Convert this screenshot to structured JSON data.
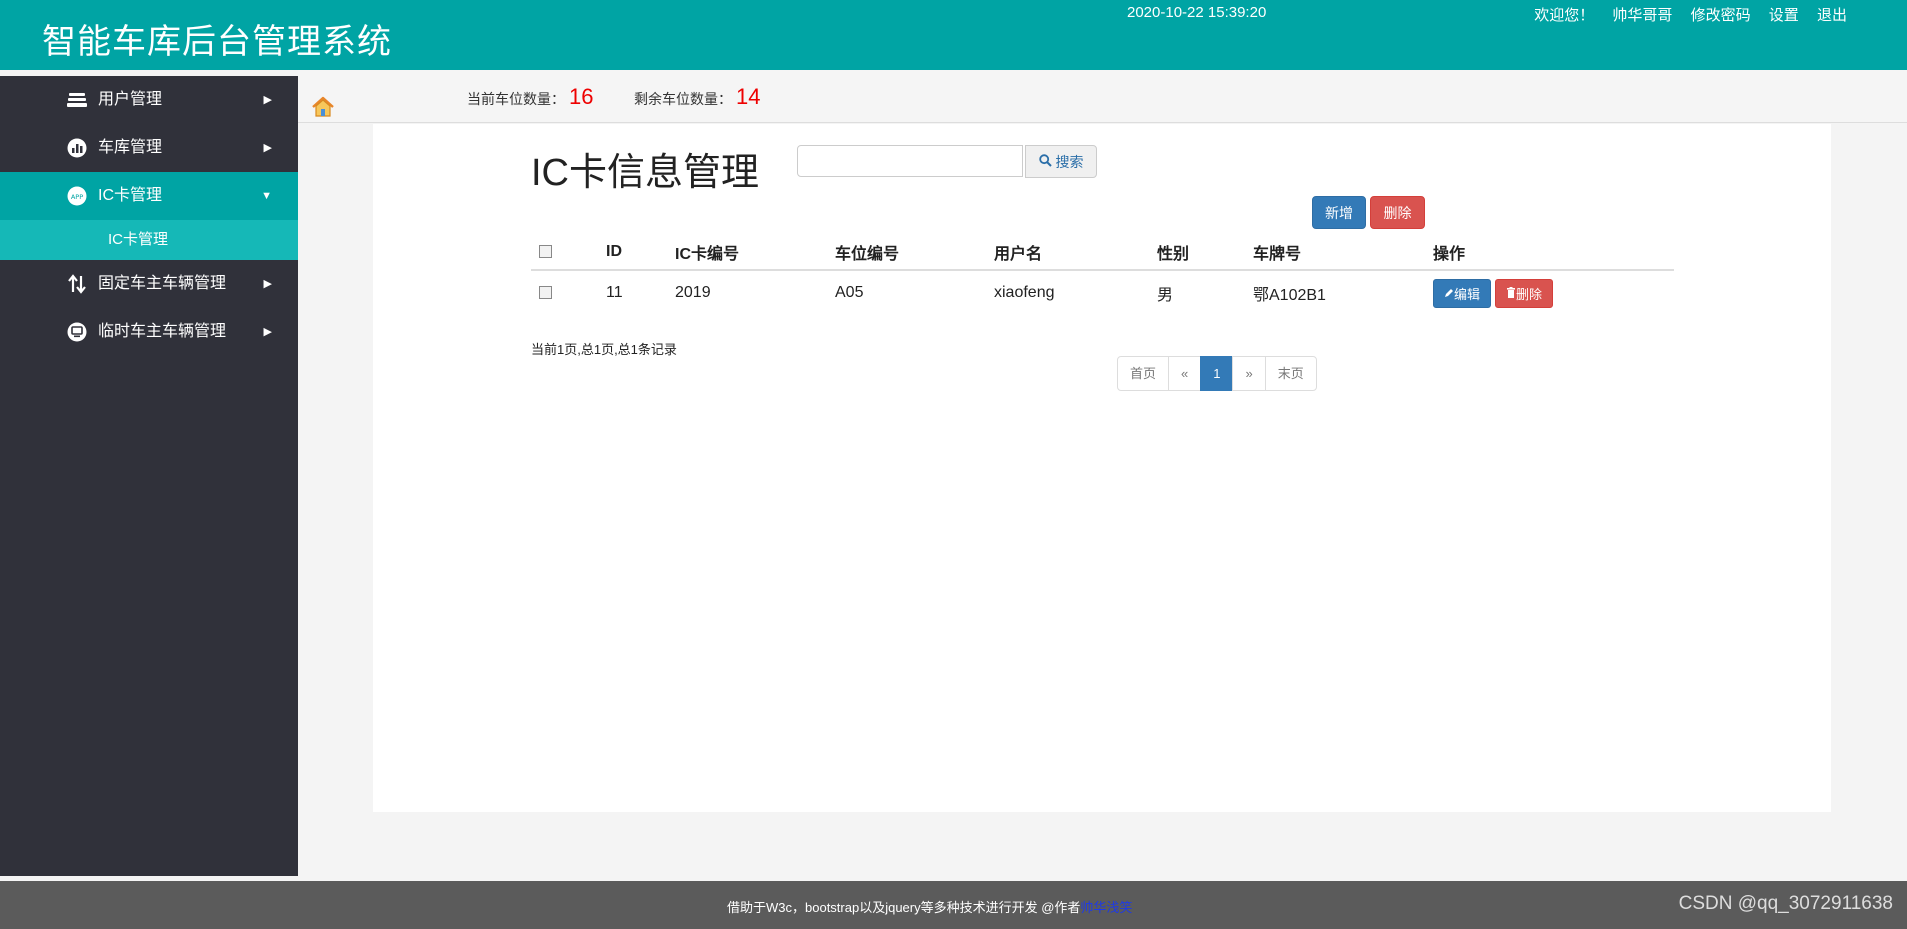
{
  "header": {
    "title": "智能车库后台管理系统",
    "datetime": "2020-10-22 15:39:20",
    "welcome": "欢迎您！",
    "username": "帅华哥哥",
    "change_password": "修改密码",
    "settings": "设置",
    "logout": "退出"
  },
  "sidebar": {
    "items": [
      {
        "label": "用户管理",
        "icon": "layers-icon"
      },
      {
        "label": "车库管理",
        "icon": "chart-icon"
      },
      {
        "label": "IC卡管理",
        "icon": "app-icon",
        "active": true,
        "sub": "IC卡管理"
      },
      {
        "label": "固定车主车辆管理",
        "icon": "swap-icon"
      },
      {
        "label": "临时车主车辆管理",
        "icon": "monitor-icon"
      }
    ]
  },
  "stats": {
    "current_label": "当前车位数量：",
    "current_value": "16",
    "remaining_label": "剩余车位数量：",
    "remaining_value": "14"
  },
  "main": {
    "title": "IC卡信息管理",
    "search_placeholder": "",
    "search_label": "搜索",
    "add_label": "新增",
    "delete_label": "删除",
    "columns": [
      "ID",
      "IC卡编号",
      "车位编号",
      "用户名",
      "性别",
      "车牌号",
      "操作"
    ],
    "rows": [
      {
        "id": "11",
        "card_no": "2019",
        "slot_no": "A05",
        "username": "xiaofeng",
        "gender": "男",
        "plate": "鄂A102B1"
      }
    ],
    "row_edit_label": "编辑",
    "row_delete_label": "删除",
    "page_info": "当前1页,总1页,总1条记录",
    "pagination": [
      "首页",
      "«",
      "1",
      "»",
      "末页"
    ]
  },
  "footer": {
    "credit": "借助于W3c，bootstrap以及jquery等多种技术进行开发 @作者",
    "author": "帅华浅笑",
    "watermark": "CSDN @qq_3072911638"
  },
  "colors": {
    "brand": "#00a4a4",
    "sidebar_bg": "#30313a",
    "submenu_bg": "#15b8b7",
    "primary": "#337ab7",
    "danger": "#d9534f",
    "count": "#ee0000"
  }
}
